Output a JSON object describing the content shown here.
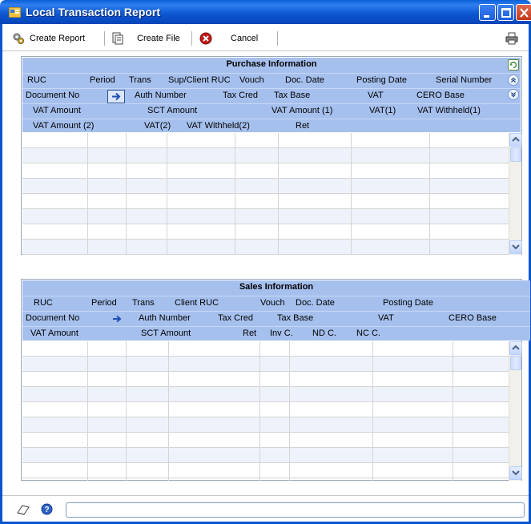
{
  "window": {
    "title": "Local Transaction Report"
  },
  "toolbar": {
    "create_report": "Create Report",
    "create_file": "Create File",
    "cancel": "Cancel"
  },
  "purchase": {
    "title": "Purchase Information",
    "row1": [
      "RUC",
      "Period",
      "Trans",
      "Sup/Client RUC",
      "Vouch",
      "Doc. Date",
      "Posting Date",
      "Serial Number"
    ],
    "row2": [
      "Document No",
      "Auth Number",
      "Tax Cred",
      "Tax Base",
      "VAT",
      "CERO Base"
    ],
    "row3": [
      "VAT Amount",
      "SCT Amount",
      "VAT Amount (1)",
      "VAT(1)",
      "VAT Withheld(1)"
    ],
    "row4": [
      "VAT Amount (2)",
      "VAT(2)",
      "VAT Withheld(2)",
      "Ret"
    ]
  },
  "sales": {
    "title": "Sales Information",
    "row1": [
      "RUC",
      "Period",
      "Trans",
      "Client RUC",
      "Vouch",
      "Doc. Date",
      "Posting Date"
    ],
    "row2": [
      "Document No",
      "Auth Number",
      "Tax Cred",
      "Tax Base",
      "VAT",
      "CERO Base"
    ],
    "row3": [
      "VAT Amount",
      "SCT Amount",
      "Ret",
      "Inv C.",
      "ND C.",
      "NC C."
    ]
  },
  "icons": {
    "app": "report-window-icon",
    "create_report": "gears-icon",
    "create_file": "document-icon",
    "cancel": "red-x-icon",
    "print": "printer-icon",
    "refresh": "refresh-icon",
    "expand": "expand-icon",
    "collapse": "collapse-icon",
    "note": "note-icon",
    "help": "help-icon",
    "arrow": "right-arrow-icon"
  },
  "colors": {
    "header_bg": "#a6c0ee",
    "title_bar": "#0a55d0"
  }
}
